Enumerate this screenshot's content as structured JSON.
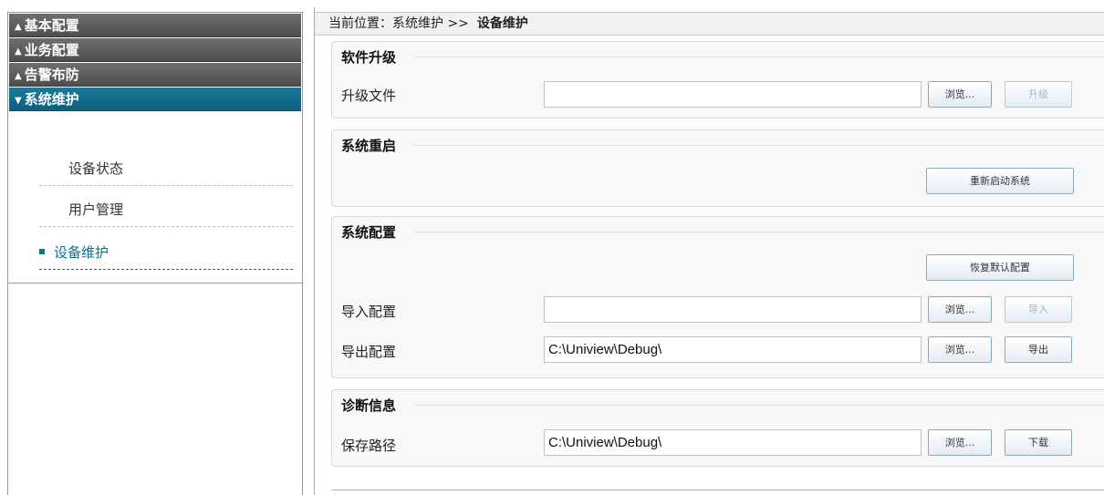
{
  "sidebar": {
    "sections": [
      {
        "label": "基本配置",
        "arrow": "▲",
        "active": false
      },
      {
        "label": "业务配置",
        "arrow": "▲",
        "active": false
      },
      {
        "label": "告警布防",
        "arrow": "▲",
        "active": false
      },
      {
        "label": "系统维护",
        "arrow": "▼",
        "active": true
      }
    ],
    "items": [
      {
        "label": "设备状态"
      },
      {
        "label": "用户管理"
      },
      {
        "label": "设备维护",
        "selected": true
      }
    ]
  },
  "breadcrumb": {
    "prefix": "当前位置：",
    "parent": "系统维护 >>",
    "current": "设备维护"
  },
  "software_upgrade": {
    "title": "软件升级",
    "file_label": "升级文件",
    "file_value": "",
    "browse_label": "浏览...",
    "upgrade_label": "升级"
  },
  "system_reboot": {
    "title": "系统重启",
    "reboot_label": "重新启动系统"
  },
  "system_config": {
    "title": "系统配置",
    "restore_label": "恢复默认配置",
    "import_label": "导入配置",
    "import_value": "",
    "import_browse_label": "浏览...",
    "import_button_label": "导入",
    "export_label": "导出配置",
    "export_value": "C:\\Uniview\\Debug\\",
    "export_browse_label": "浏览...",
    "export_button_label": "导出"
  },
  "diagnostics": {
    "title": "诊断信息",
    "path_label": "保存路径",
    "path_value": "C:\\Uniview\\Debug\\",
    "browse_label": "浏览...",
    "download_label": "下载"
  },
  "colors": {
    "active_nav": "#0f6f95",
    "inactive_nav": "#5e5e5e",
    "button_border": "#8aa9bf",
    "group_bg": "#f8f8f8"
  }
}
